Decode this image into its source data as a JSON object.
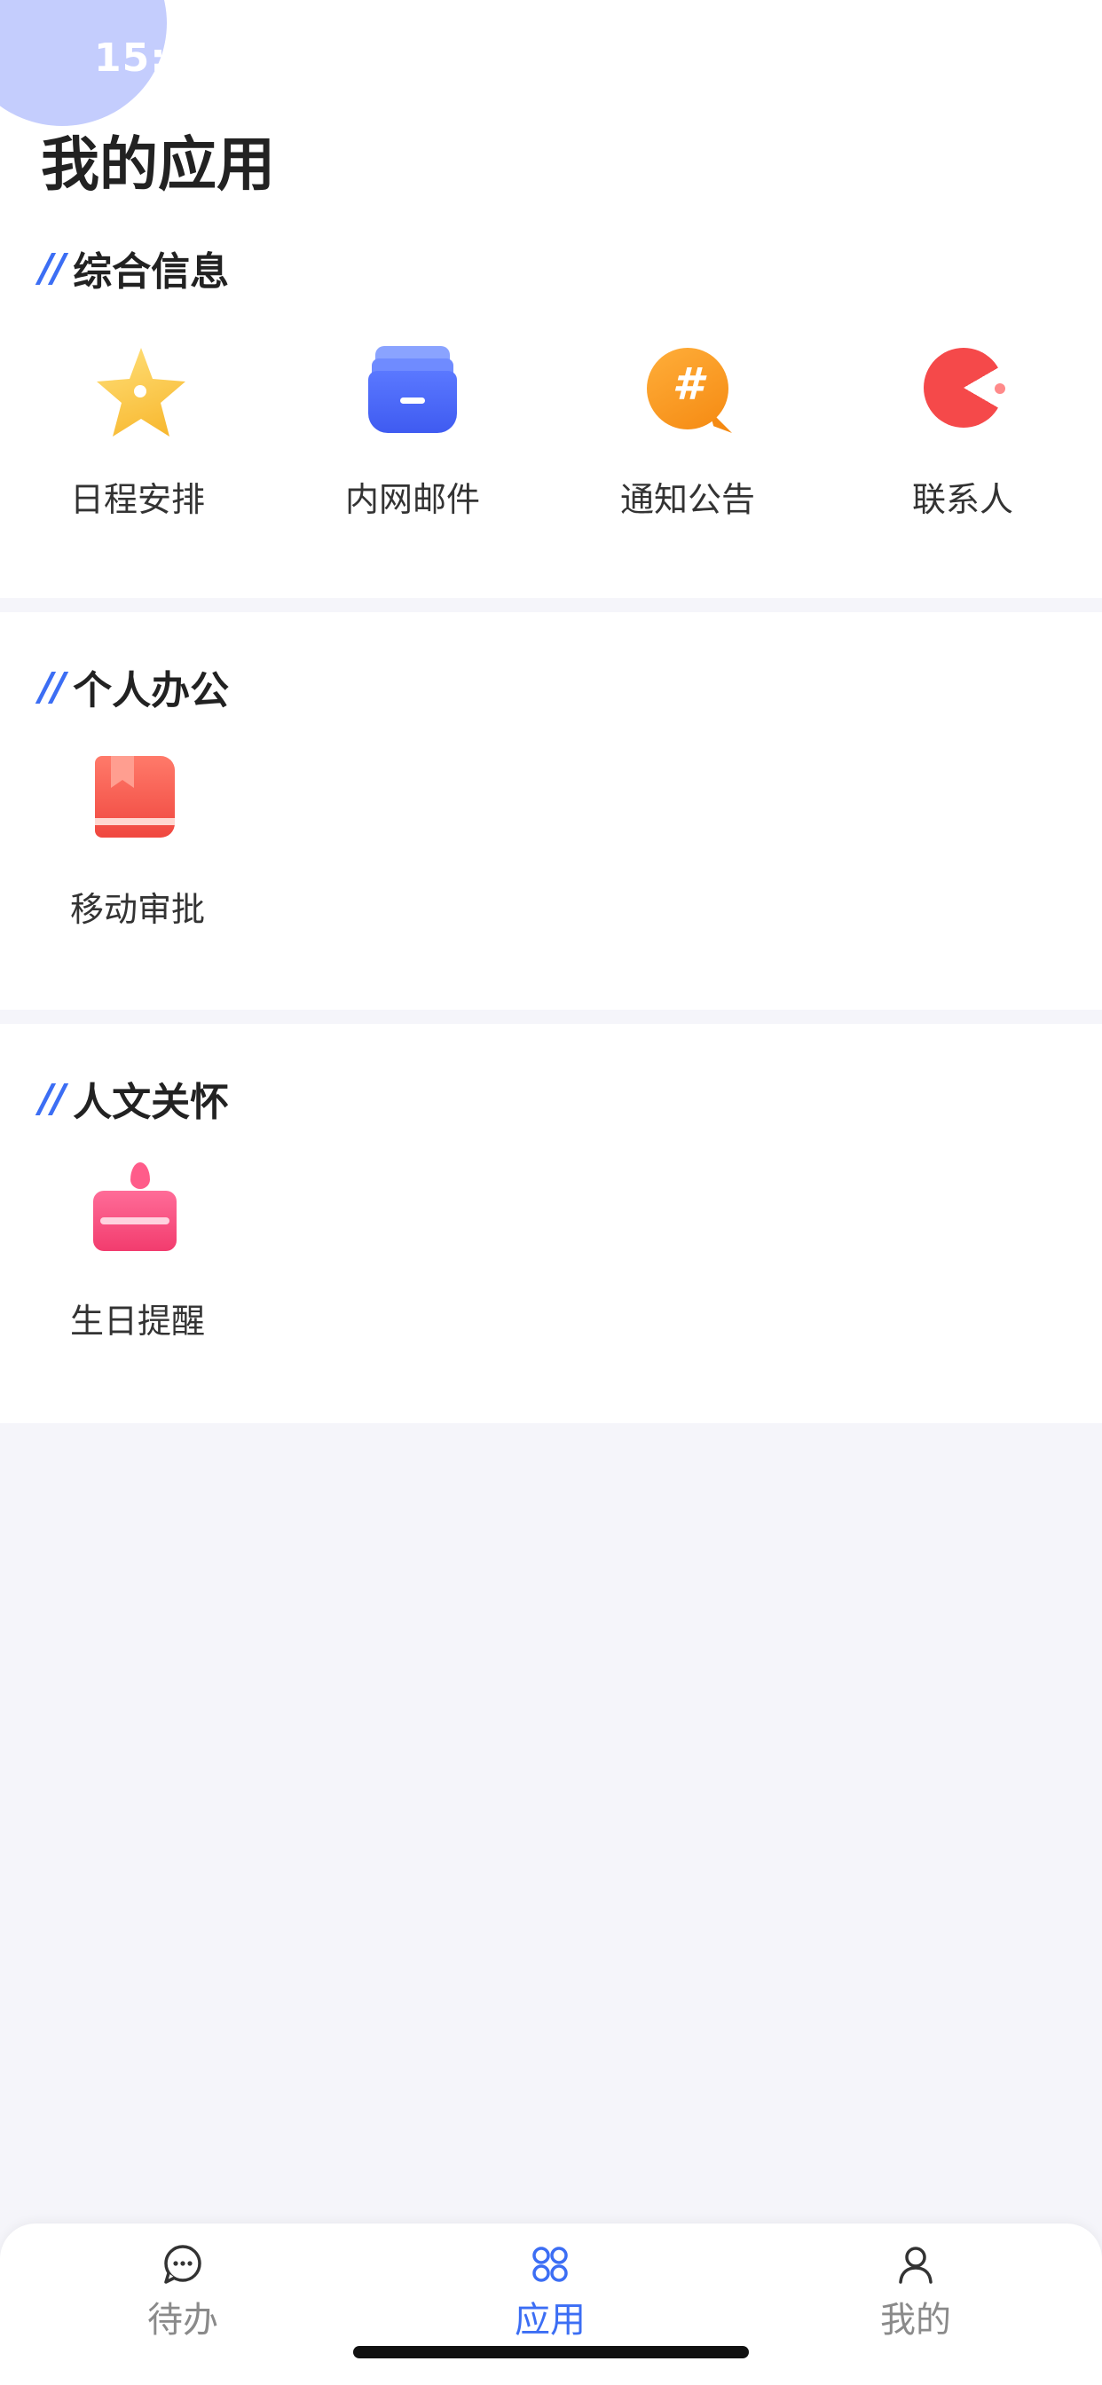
{
  "status_bar": {
    "time": "15:"
  },
  "header": {
    "title": "我的应用"
  },
  "sections": [
    {
      "title": "综合信息",
      "apps": [
        {
          "label": "日程安排",
          "icon": "star-icon"
        },
        {
          "label": "内网邮件",
          "icon": "mailbox-icon"
        },
        {
          "label": "通知公告",
          "icon": "hash-bubble-icon"
        },
        {
          "label": "联系人",
          "icon": "pacman-contact-icon"
        }
      ]
    },
    {
      "title": "个人办公",
      "apps": [
        {
          "label": "移动审批",
          "icon": "book-icon"
        }
      ]
    },
    {
      "title": "人文关怀",
      "apps": [
        {
          "label": "生日提醒",
          "icon": "cake-icon"
        }
      ]
    }
  ],
  "tabbar": {
    "tabs": [
      {
        "label": "待办",
        "icon": "chat-bubble-icon",
        "active": false
      },
      {
        "label": "应用",
        "icon": "grid-app-icon",
        "active": true
      },
      {
        "label": "我的",
        "icon": "person-icon",
        "active": false
      }
    ]
  },
  "colors": {
    "accent": "#3c6ef4",
    "background": "#f5f5fa",
    "inactive_tab": "#8a8a8a"
  }
}
